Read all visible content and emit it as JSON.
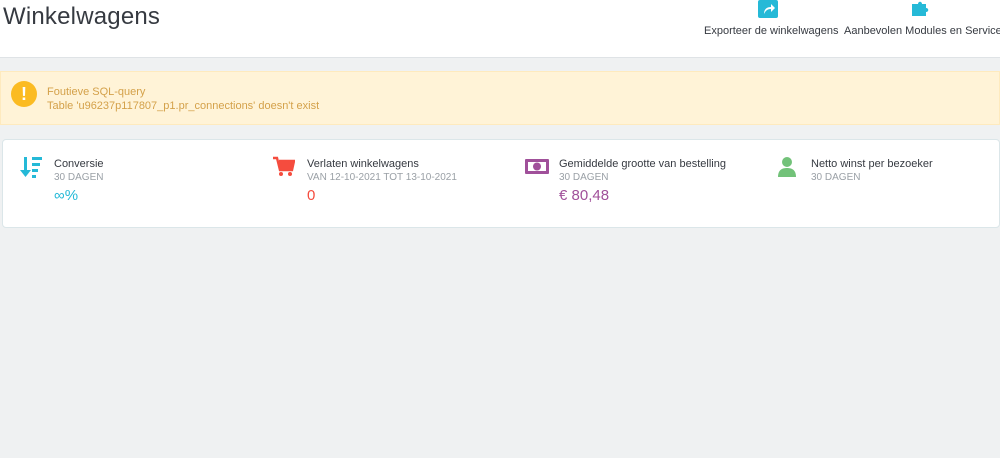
{
  "page": {
    "title": "Winkelwagens"
  },
  "toolbar": {
    "export_label": "Exporteer de winkelwagens",
    "modules_label": "Aanbevolen Modules en Services"
  },
  "alert": {
    "icon": "!",
    "title": "Foutieve SQL-query",
    "message": "Table 'u96237p117807_p1.pr_connections' doesn't exist"
  },
  "kpis": [
    {
      "icon": "sort-amount-down-icon",
      "title": "Conversie",
      "subtitle": "30 DAGEN",
      "value": "∞%",
      "color": "#25b9d7"
    },
    {
      "icon": "cart-icon",
      "title": "Verlaten winkelwagens",
      "subtitle": "VAN 12-10-2021 TOT 13-10-2021",
      "value": "0",
      "color": "#f54c3e"
    },
    {
      "icon": "money-icon",
      "title": "Gemiddelde grootte van bestelling",
      "subtitle": "30 DAGEN",
      "value": "€ 80,48",
      "color": "#a0509a"
    },
    {
      "icon": "user-icon",
      "title": "Netto winst per bezoeker",
      "subtitle": "30 DAGEN",
      "value": "",
      "color": "#72c279"
    }
  ],
  "colors": {
    "accent": "#25b9d7",
    "alert_bg": "#fff3d7",
    "alert_text": "#d4a14a",
    "alert_icon": "#fbbb22"
  }
}
